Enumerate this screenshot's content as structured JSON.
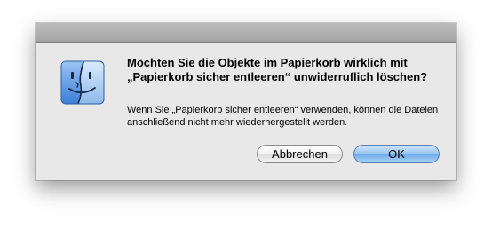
{
  "dialog": {
    "heading": "Möchten Sie die Objekte im Papierkorb wirklich mit „Papierkorb sicher entleeren“ unwiderruflich löschen?",
    "message": "Wenn Sie „Papierkorb sicher entleeren“ verwenden, können die Dateien anschließend nicht mehr wiederhergestellt werden.",
    "icon": "finder-icon",
    "buttons": {
      "cancel_label": "Abbrechen",
      "ok_label": "OK"
    }
  },
  "colors": {
    "dialog_background": "#e8e8e8",
    "titlebar": "#a4a4a4",
    "default_button": "#6eaae8",
    "finder_blue": "#4b8fe0"
  }
}
